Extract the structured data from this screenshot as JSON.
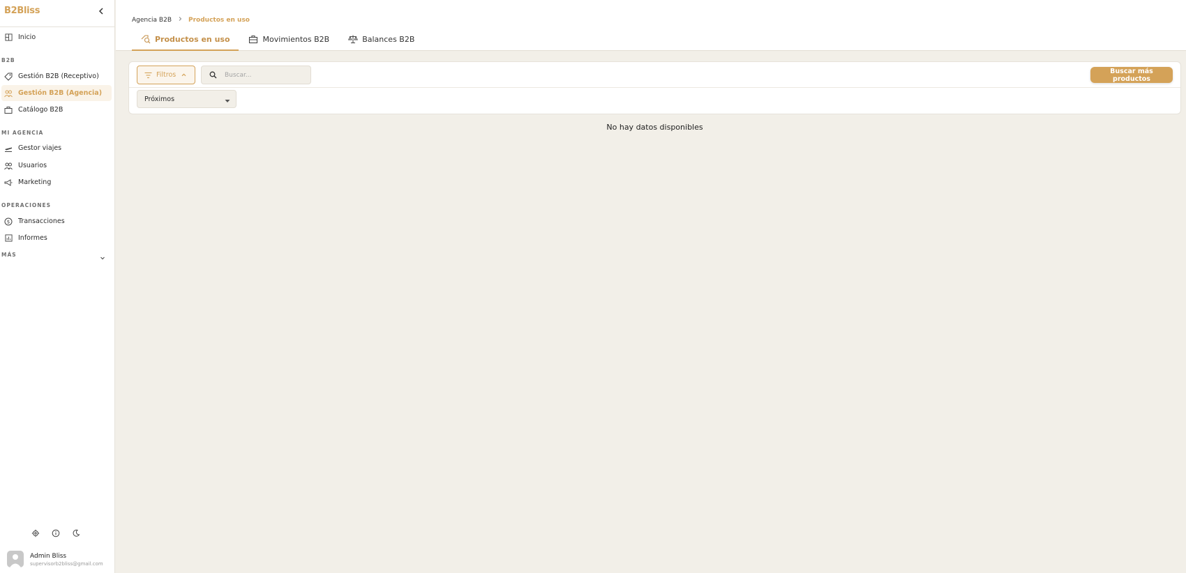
{
  "brand": {
    "name": "B2Bliss",
    "accent": "#d4a258"
  },
  "sidebar": {
    "collapse_icon": "chevron-left-icon",
    "top_items": [
      {
        "label": "Inicio",
        "icon": "dashboard-icon"
      }
    ],
    "sections": [
      {
        "title": "B2B",
        "items": [
          {
            "label": "Gestión B2B (Receptivo)",
            "icon": "tag-icon"
          },
          {
            "label": "Gestión B2B (Agencia)",
            "icon": "users-icon",
            "active": true
          },
          {
            "label": "Catálogo B2B",
            "icon": "briefcase-icon"
          }
        ]
      },
      {
        "title": "MI AGENCIA",
        "items": [
          {
            "label": "Gestor viajes",
            "icon": "plane-icon"
          },
          {
            "label": "Usuarios",
            "icon": "users-icon"
          },
          {
            "label": "Marketing",
            "icon": "megaphone-icon"
          }
        ]
      },
      {
        "title": "OPERACIONES",
        "items": [
          {
            "label": "Transacciones",
            "icon": "dollar-icon"
          },
          {
            "label": "Informes",
            "icon": "report-icon"
          }
        ]
      }
    ],
    "more": {
      "label": "MÁS",
      "icon": "chevron-down-icon"
    },
    "bottom_icons": [
      "gear-icon",
      "info-icon",
      "moon-icon"
    ],
    "user": {
      "name": "Admin Bliss",
      "email": "supervisorb2bliss@gmail.com"
    }
  },
  "header": {
    "breadcrumb": [
      "Agencia B2B",
      "Productos en uso"
    ],
    "tabs": [
      {
        "label": "Productos en uso",
        "icon": "search-tag-icon",
        "active": true
      },
      {
        "label": "Movimientos B2B",
        "icon": "briefcase-icon"
      },
      {
        "label": "Balances B2B",
        "icon": "scale-icon"
      }
    ]
  },
  "toolbar": {
    "filters_label": "Filtros",
    "search_placeholder": "Buscar...",
    "primary_button": "Buscar más productos",
    "select_value": "Próximos"
  },
  "empty_message": "No hay datos disponibles"
}
